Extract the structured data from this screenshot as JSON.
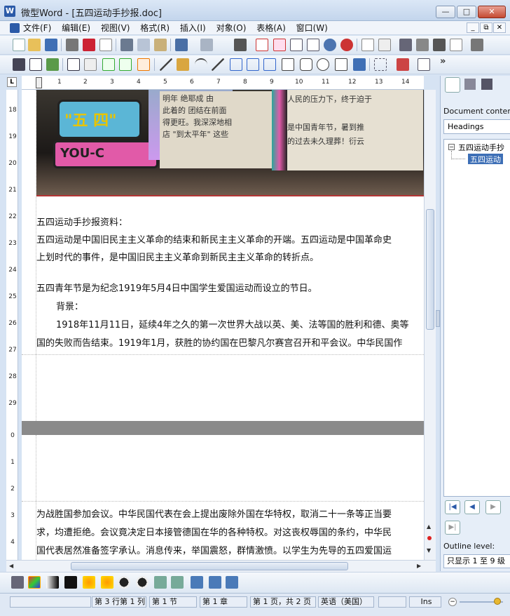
{
  "window": {
    "title": "微型Word - [五四运动手抄报.doc]",
    "app_icon": "W"
  },
  "window_controls": {
    "minimize": "—",
    "maximize": "□",
    "close": "✕"
  },
  "menu": [
    "文件(F)",
    "编辑(E)",
    "视图(V)",
    "格式(R)",
    "插入(I)",
    "对象(O)",
    "表格(A)",
    "窗口(W)"
  ],
  "mdi_controls": [
    "_",
    "⧉",
    "✕"
  ],
  "ruler": {
    "corner": "L",
    "numbers": [
      "1",
      "2",
      "3",
      "4",
      "5",
      "6",
      "7",
      "8",
      "9",
      "10",
      "11",
      "12",
      "13",
      "14"
    ]
  },
  "vertical_ruler": [
    "18",
    "19",
    "20",
    "21",
    "22",
    "23",
    "24",
    "25",
    "26",
    "27",
    "28",
    "29",
    "0",
    "1",
    "2",
    "3",
    "4"
  ],
  "document": {
    "page1_lines": [
      "五四运动手抄报资料：",
      "五四运动是中国旧民主主义革命的结束和新民主主义革命的开端。五四运动是中国革命史",
      "上划时代的事件，是中国旧民主主义革命到新民主主义革命的转折点。",
      "五四青年节是为纪念1919年5月4日中国学生爱国运动而设立的节日。",
      "背景：",
      "1918年11月11日，延续4年之久的第一次世界大战以英、美、法等国的胜利和德、奥等",
      "国的失败而告结束。1919年1月，获胜的协约国在巴黎凡尔赛宫召开和平会议。中华民国作"
    ],
    "page2_lines": [
      "为战胜国参加会议。中华民国代表在会上提出废除外国在华特权，取消二十一条等正当要",
      "求，均遭拒绝。会议竟决定日本接管德国在华的各种特权。对这丧权辱国的条约，中华民",
      "国代表居然准备签字承认。消息传来，举国震怒，群情激愤。以学生为先导的五四爱国运"
    ],
    "poster_text": [
      "\"五 四\"",
      "YOU-C",
      "人民的压力下，终于迫于",
      "是中国青年节，暑到推",
      "的过去未久理葬！衍云",
      "明年 绝耶成 由",
      "此着的 团结在前面",
      "得更旺。我深深地相",
      "店 \"到太平年\" 这些"
    ]
  },
  "right_panel": {
    "label": "Document content",
    "select_value": "Headings",
    "tree_root": "五四运动手抄",
    "tree_child": "五四运动",
    "outline_label": "Outline level:",
    "outline_value": "只显示 1 至 9 级"
  },
  "statusbar": {
    "position": "第 3 行第 1 列",
    "section": "第 1 节",
    "chapter": "第 1 章",
    "page": "第 1 页，共 2 页",
    "language": "英语（美国）",
    "mode": "Ins"
  },
  "colors": {
    "accent": "#2b5aa8",
    "poster_border": "#b43535",
    "tree_highlight": "#3d6fb6"
  }
}
